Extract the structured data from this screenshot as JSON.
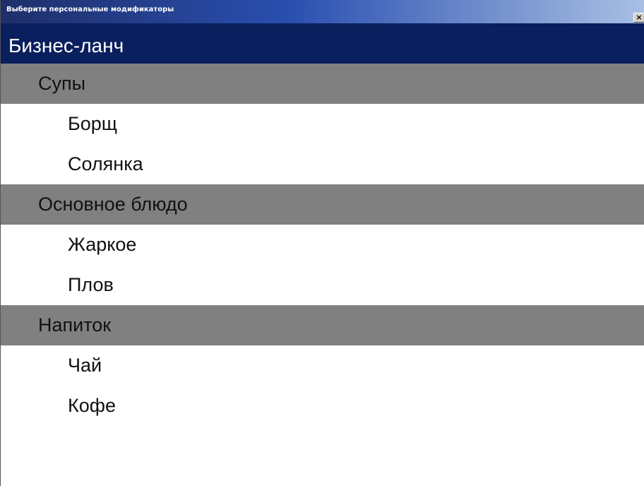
{
  "window": {
    "title": "Выберите персональные модификаторы",
    "close_label": "×"
  },
  "menu": {
    "title": "Бизнес-ланч",
    "groups": [
      {
        "category": "Супы",
        "items": [
          "Борщ",
          "Солянка"
        ]
      },
      {
        "category": "Основное блюдо",
        "items": [
          "Жаркое",
          "Плов"
        ]
      },
      {
        "category": "Напиток",
        "items": [
          "Чай",
          "Кофе"
        ]
      }
    ]
  },
  "colors": {
    "title_bar_start": "#1e2f6a",
    "title_bar_end": "#a9c0e4",
    "header_background": "#0a1f5e",
    "category_background": "#808080",
    "item_background": "#ffffff"
  }
}
